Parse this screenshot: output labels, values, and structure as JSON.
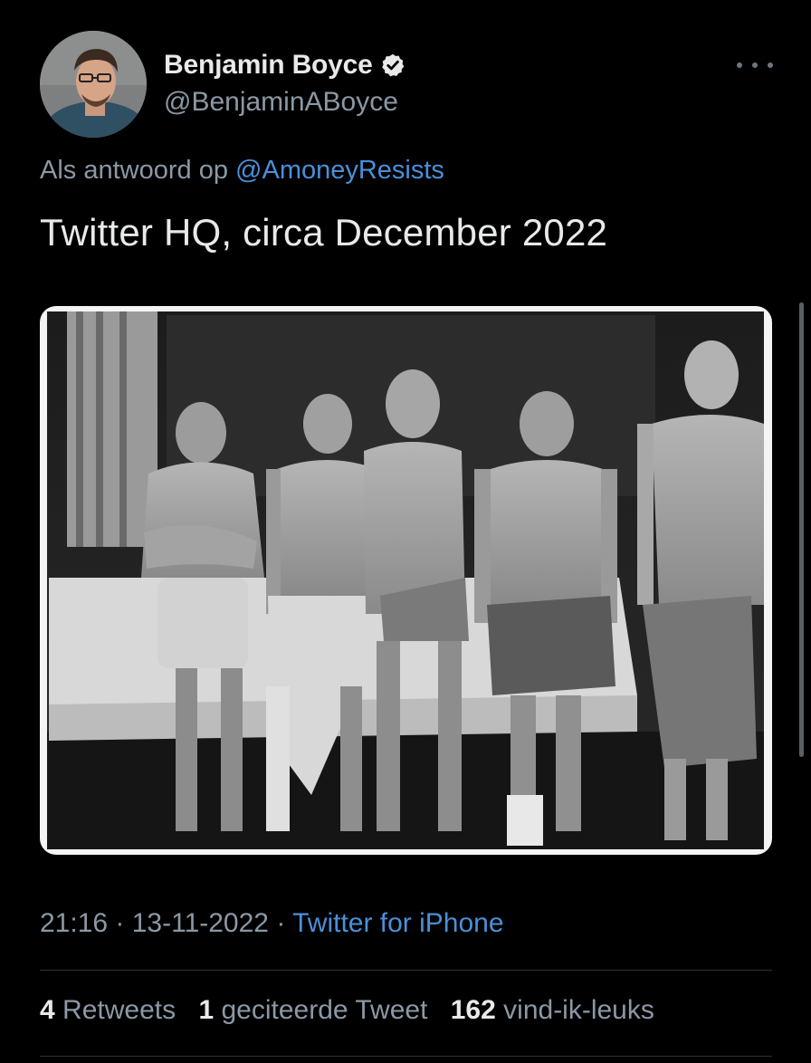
{
  "author": {
    "display_name": "Benjamin Boyce",
    "handle": "@BenjaminABoyce",
    "verified_icon": "verified-badge-icon"
  },
  "reply": {
    "prefix": "Als antwoord op",
    "to_handle": "@AmoneyResists"
  },
  "tweet": {
    "text": "Twitter HQ, circa December 2022"
  },
  "meta": {
    "time": "21:16",
    "separator1": " · ",
    "date": "13-11-2022",
    "separator2": " · ",
    "source": "Twitter for iPhone"
  },
  "stats": {
    "retweets_count": "4",
    "retweets_label": "Retweets",
    "quotes_count": "1",
    "quotes_label": "geciteerde Tweet",
    "likes_count": "162",
    "likes_label": "vind-ik-leuks"
  },
  "colors": {
    "background": "#000000",
    "text_primary": "#e7e9ea",
    "text_secondary": "#8b98a5",
    "link": "#4a90d9",
    "divider": "#2f3336"
  }
}
